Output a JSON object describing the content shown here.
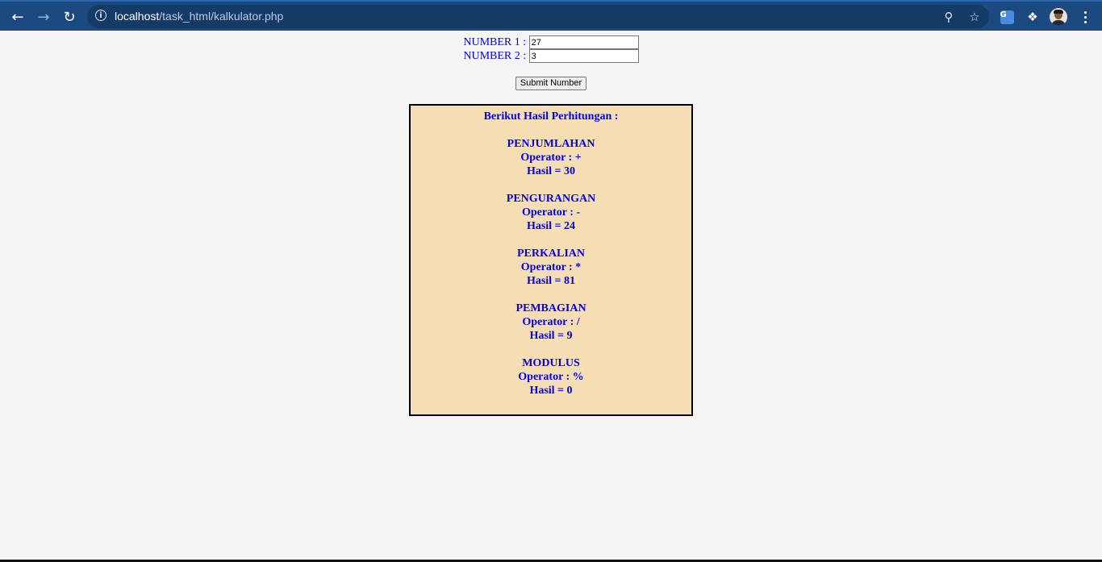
{
  "browser": {
    "url_host": "localhost",
    "url_path": "/task_html/kalkulator.php"
  },
  "form": {
    "number1_label": "NUMBER 1 :",
    "number1_value": "27",
    "number2_label": "NUMBER 2 :",
    "number2_value": "3",
    "submit_label": "Submit Number"
  },
  "result": {
    "heading": "Berikut Hasil Perhitungan :",
    "operations": [
      {
        "name": "PENJUMLAHAN",
        "operator": "Operator : +",
        "result": "Hasil = 30"
      },
      {
        "name": "PENGURANGAN",
        "operator": "Operator : -",
        "result": "Hasil = 24"
      },
      {
        "name": "PERKALIAN",
        "operator": "Operator : *",
        "result": "Hasil = 81"
      },
      {
        "name": "PEMBAGIAN",
        "operator": "Operator : /",
        "result": "Hasil = 9"
      },
      {
        "name": "MODULUS",
        "operator": "Operator : %",
        "result": "Hasil = 0"
      }
    ]
  },
  "colors": {
    "text": "#0000ee",
    "box_background": "#f5deb3",
    "chrome": "#1c4a80"
  },
  "icons": [
    "back-icon",
    "forward-icon",
    "reload-icon",
    "site-info-icon",
    "zoom-icon",
    "bookmark-star-icon",
    "translate-icon",
    "extensions-puzzle-icon",
    "profile-avatar",
    "menu-dots-icon"
  ]
}
